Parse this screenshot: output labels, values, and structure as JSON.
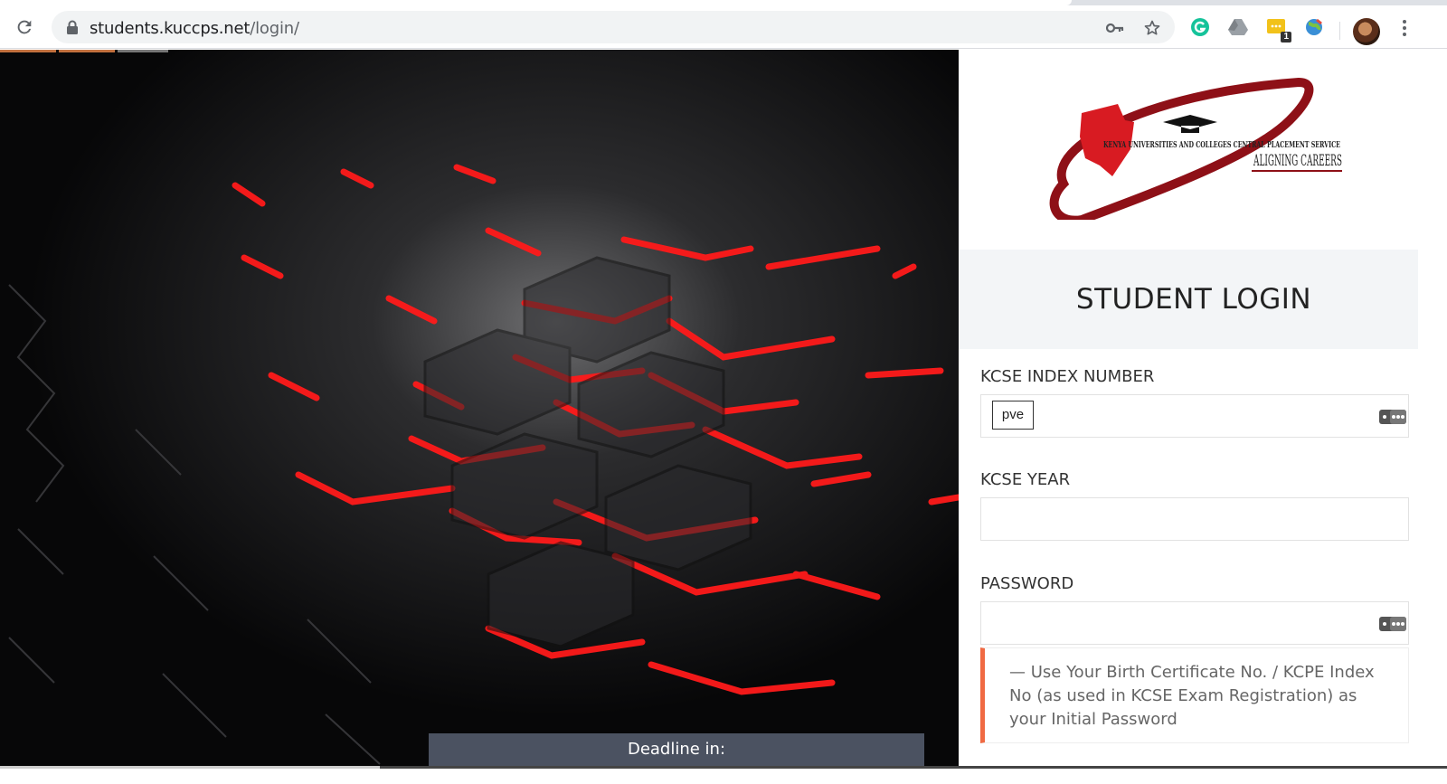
{
  "browser": {
    "url_host": "students.kuccps.net",
    "url_path": "/login/",
    "extension_badge": "1"
  },
  "hero": {
    "deadline_label": "Deadline in:"
  },
  "logo": {
    "org_name": "KENYA UNIVERSITIES AND COLLEGES CENTRAL PLACEMENT SERVICE",
    "tagline": "ALIGNING CAREERS"
  },
  "login": {
    "title": "STUDENT LOGIN",
    "index_label": "KCSE INDEX NUMBER",
    "index_autofill_chip": "pve",
    "year_label": "KCSE YEAR",
    "password_label": "PASSWORD",
    "password_note": "— Use Your Birth Certificate No. / KCPE Index No (as used in KCSE Exam Registration) as your Initial Password"
  },
  "colors": {
    "accent": "#f06a43",
    "brand_red": "#a3141e",
    "deadline_bar": "#4b5261"
  }
}
